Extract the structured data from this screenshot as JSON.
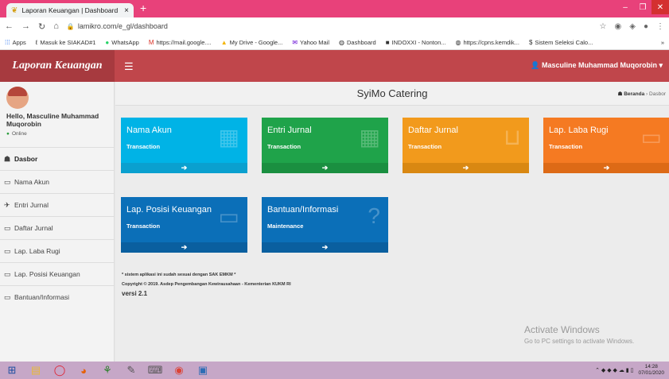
{
  "browser": {
    "tab_title": "Laporan Keuangan | Dashboard",
    "tab_close": "×",
    "new_tab": "+",
    "url": "lamikro.com/e_gl/dashboard",
    "bookmarks": [
      "Apps",
      "Masuk ke SIAKAD#1",
      "WhatsApp",
      "https://mail.google....",
      "My Drive - Google...",
      "Yahoo Mail",
      "Dashboard",
      "INDOXXI - Nonton...",
      "https://cpns.kemdik...",
      "Sistem Seleksi Calo..."
    ],
    "more": "»"
  },
  "app": {
    "brand": "Laporan Keuangan",
    "user_name": "Masculine Muhammad Muqorobin",
    "profile_hello": "Hello, Masculine Muhammad Muqorobin",
    "profile_status": "Online"
  },
  "sidebar": {
    "items": [
      {
        "label": "Dasbor",
        "icon": "dashboard-icon",
        "glyph": "☗"
      },
      {
        "label": "Nama Akun",
        "icon": "laptop-icon",
        "glyph": "▭"
      },
      {
        "label": "Entri Jurnal",
        "icon": "plane-icon",
        "glyph": "✈"
      },
      {
        "label": "Daftar Jurnal",
        "icon": "laptop-icon",
        "glyph": "▭"
      },
      {
        "label": "Lap. Laba Rugi",
        "icon": "laptop-icon",
        "glyph": "▭"
      },
      {
        "label": "Lap. Posisi Keuangan",
        "icon": "laptop-icon",
        "glyph": "▭"
      },
      {
        "label": "Bantuan/Informasi",
        "icon": "monitor-icon",
        "glyph": "▭"
      }
    ]
  },
  "main": {
    "title": "SyiMo Catering",
    "breadcrumb_home": "Beranda",
    "breadcrumb_sep": "›",
    "breadcrumb_current": "Dasbor",
    "boxes": [
      {
        "title": "Nama Akun",
        "subtitle": "Transaction",
        "color": "#00b3e6",
        "footer": "#0aa0cf",
        "icon": "calendar-icon",
        "glyph": "▦"
      },
      {
        "title": "Entri Jurnal",
        "subtitle": "Transaction",
        "color": "#1fa34a",
        "footer": "#1a8f40",
        "icon": "calculator-icon",
        "glyph": "▦"
      },
      {
        "title": "Daftar Jurnal",
        "subtitle": "Transaction",
        "color": "#f29a1c",
        "footer": "#d98812",
        "icon": "inbox-icon",
        "glyph": "⊔"
      },
      {
        "title": "Lap. Laba Rugi",
        "subtitle": "Transaction",
        "color": "#f57a22",
        "footer": "#dd6a16",
        "icon": "monitor-icon",
        "glyph": "▭"
      },
      {
        "title": "Lap. Posisi Keuangan",
        "subtitle": "Transaction",
        "color": "#0b6fb8",
        "footer": "#0a5f9f",
        "icon": "monitor-icon",
        "glyph": "▭"
      },
      {
        "title": "Bantuan/Informasi",
        "subtitle": "Maintenance",
        "color": "#0b6fb8",
        "footer": "#0a5f9f",
        "icon": "question-icon",
        "glyph": "?"
      }
    ],
    "box_more": "➔",
    "note": "* sistem aplikasi ini sudah sesuai dengan SAK EMKM *",
    "copyright": "Copyright © 2019. Asdep Pengembangan Kewirausahaan - Kementerian KUKM RI",
    "version": "versi 2.1"
  },
  "watermark": {
    "line1": "Activate Windows",
    "line2": "Go to PC settings to activate Windows."
  },
  "taskbar": {
    "time": "14:28",
    "date": "07/01/2020"
  }
}
